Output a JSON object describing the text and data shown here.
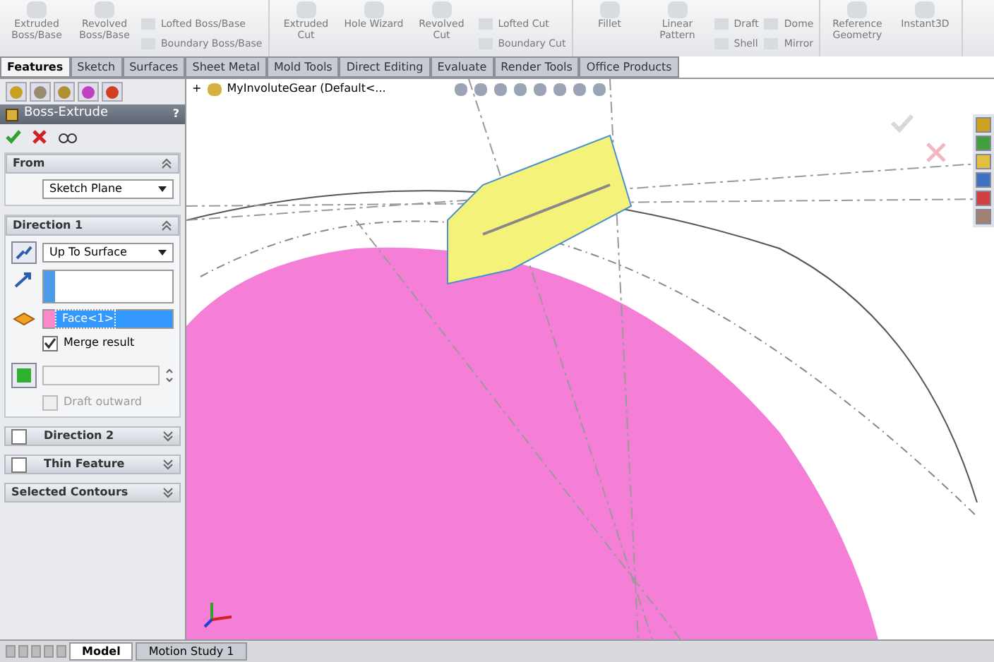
{
  "toolbar": {
    "groups": [
      {
        "items": [
          {
            "kind": "large",
            "label": "Extruded Boss/Base"
          },
          {
            "kind": "large",
            "label": "Revolved Boss/Base"
          },
          {
            "kind": "stack",
            "labels": [
              "Lofted Boss/Base",
              "Boundary Boss/Base"
            ]
          }
        ]
      },
      {
        "items": [
          {
            "kind": "large",
            "label": "Extruded Cut"
          },
          {
            "kind": "large",
            "label": "Hole Wizard"
          },
          {
            "kind": "large",
            "label": "Revolved Cut"
          },
          {
            "kind": "stack",
            "labels": [
              "Lofted Cut",
              "Boundary Cut"
            ]
          }
        ]
      },
      {
        "items": [
          {
            "kind": "large",
            "label": "Fillet"
          },
          {
            "kind": "large",
            "label": "Linear Pattern"
          },
          {
            "kind": "stack",
            "labels": [
              "Draft",
              "Shell"
            ]
          },
          {
            "kind": "stack",
            "labels": [
              "Dome",
              "Mirror"
            ]
          }
        ]
      },
      {
        "items": [
          {
            "kind": "large",
            "label": "Reference Geometry"
          },
          {
            "kind": "large",
            "label": "Instant3D"
          }
        ]
      }
    ]
  },
  "tabs": [
    {
      "label": "Features",
      "selected": true
    },
    {
      "label": "Sketch",
      "selected": false
    },
    {
      "label": "Surfaces",
      "selected": false
    },
    {
      "label": "Sheet Metal",
      "selected": false
    },
    {
      "label": "Mold Tools",
      "selected": false
    },
    {
      "label": "Direct Editing",
      "selected": false
    },
    {
      "label": "Evaluate",
      "selected": false
    },
    {
      "label": "Render Tools",
      "selected": false
    },
    {
      "label": "Office Products",
      "selected": false
    }
  ],
  "property_manager": {
    "title": "Boss-Extrude",
    "help": "?",
    "sections": [
      {
        "kind": "from",
        "title": "From",
        "expanded": true,
        "start": "Sketch Plane"
      },
      {
        "kind": "direction",
        "title": "Direction 1",
        "expanded": true,
        "end_condition": "Up To Surface",
        "face": "Face<1>",
        "merge_result": {
          "label": "Merge result",
          "checked": true
        },
        "draft_outward": {
          "label": "Draft outward",
          "checked": false
        }
      },
      {
        "kind": "collapsed",
        "title": "Direction 2",
        "expanded": false,
        "checked": false
      },
      {
        "kind": "collapsed",
        "title": "Thin Feature",
        "expanded": false,
        "checked": false
      },
      {
        "kind": "plain",
        "title": "Selected Contours",
        "expanded": false
      }
    ]
  },
  "tree": {
    "expand": "+",
    "label": "MyInvoluteGear  (Default<..."
  },
  "bottom_tabs": [
    {
      "label": "Model",
      "selected": true
    },
    {
      "label": "Motion Study 1",
      "selected": false
    }
  ]
}
